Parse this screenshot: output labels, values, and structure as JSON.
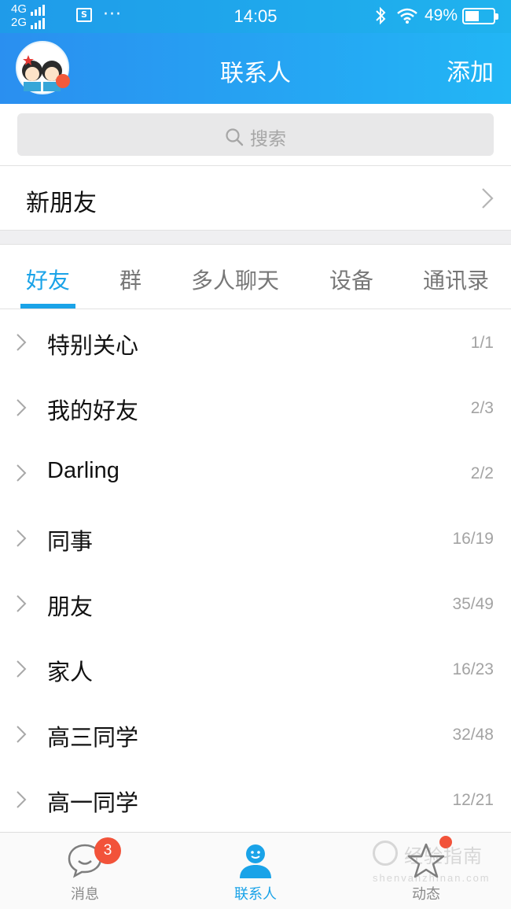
{
  "status_bar": {
    "net_top": "4G",
    "net_bottom": "2G",
    "sim_icon_text": "S",
    "dots": "···",
    "time": "14:05",
    "battery_percent": "49%",
    "battery_level": 0.49,
    "icons": [
      "signal-icon",
      "sim-card-icon",
      "bluetooth-icon",
      "wifi-icon",
      "battery-icon"
    ]
  },
  "header": {
    "title": "联系人",
    "add_label": "添加",
    "avatar": "avatar",
    "avatar_has_dot": true
  },
  "search": {
    "placeholder": "搜索",
    "icon": "search-icon"
  },
  "new_friend": {
    "label": "新朋友"
  },
  "tabs": [
    {
      "label": "好友",
      "active": true
    },
    {
      "label": "群",
      "active": false
    },
    {
      "label": "多人聊天",
      "active": false
    },
    {
      "label": "设备",
      "active": false
    },
    {
      "label": "通讯录",
      "active": false
    }
  ],
  "groups": [
    {
      "name": "特别关心",
      "count": "1/1"
    },
    {
      "name": "我的好友",
      "count": "2/3"
    },
    {
      "name": "Darling",
      "count": "2/2"
    },
    {
      "name": "同事",
      "count": "16/19"
    },
    {
      "name": "朋友",
      "count": "35/49"
    },
    {
      "name": "家人",
      "count": "16/23"
    },
    {
      "name": "高三同学",
      "count": "32/48"
    },
    {
      "name": "高一同学",
      "count": "12/21"
    }
  ],
  "tabbar": [
    {
      "label": "消息",
      "icon": "chat-bubble-icon",
      "badge": "3"
    },
    {
      "label": "联系人",
      "icon": "contacts-person-icon",
      "active": true
    },
    {
      "label": "动态",
      "icon": "star-icon",
      "has_dot": true
    }
  ],
  "watermark": {
    "line1": "经验指南",
    "line2": "shenvanzhinan.com"
  },
  "colors": {
    "accent": "#1aa3e8",
    "header_gradient_start": "#2a8ff0",
    "header_gradient_end": "#22b6f5",
    "badge_red": "#f2533a"
  }
}
